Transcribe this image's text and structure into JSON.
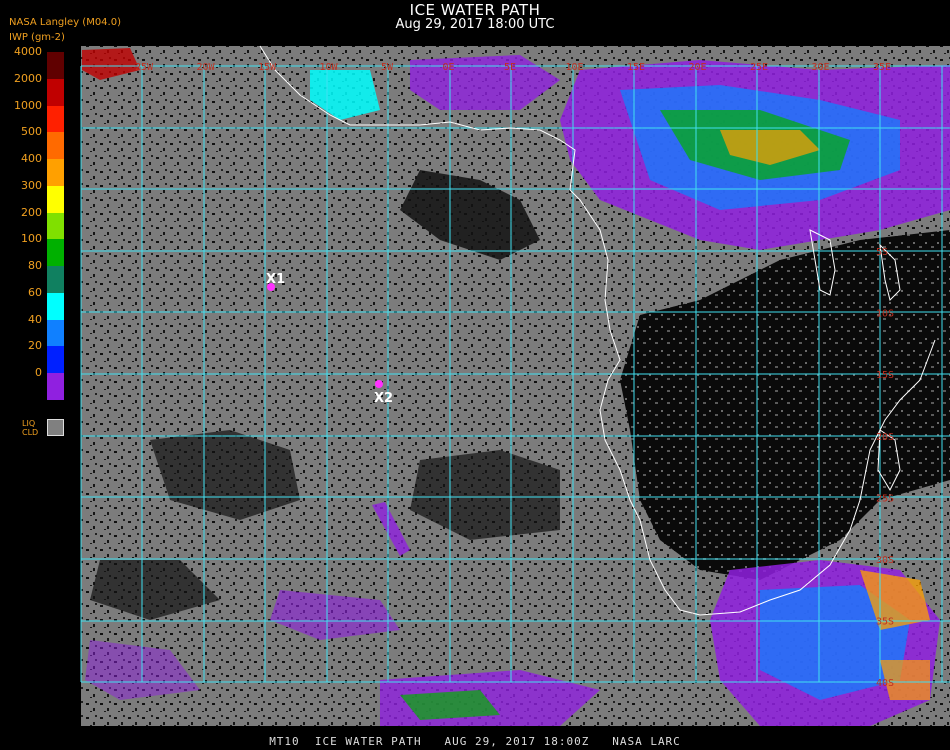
{
  "header": {
    "title": "ICE WATER PATH",
    "subtitle": "Aug 29, 2017 18:00 UTC",
    "organization": "NASA Langley (M04.0)",
    "unit_label": "IWP (gm-2)"
  },
  "legend": {
    "entries": [
      {
        "label": "4000",
        "color": "#600000"
      },
      {
        "label": "2000",
        "color": "#c00000"
      },
      {
        "label": "1000",
        "color": "#ff2000"
      },
      {
        "label": "500",
        "color": "#ff6a00"
      },
      {
        "label": "400",
        "color": "#ffa000"
      },
      {
        "label": "300",
        "color": "#ffff00"
      },
      {
        "label": "200",
        "color": "#80e000"
      },
      {
        "label": "100",
        "color": "#00b000"
      },
      {
        "label": "80",
        "color": "#108060"
      },
      {
        "label": "60",
        "color": "#00ffff"
      },
      {
        "label": "40",
        "color": "#1080ff"
      },
      {
        "label": "20",
        "color": "#0020ff"
      },
      {
        "label": "0",
        "color": "#9020e0"
      }
    ],
    "liquid_cloud_label_line1": "LIQ",
    "liquid_cloud_label_line2": "CLD",
    "liquid_cloud_color": "#808080"
  },
  "map": {
    "grid_color": "#40e0f0",
    "coast_color": "#ffffff",
    "longitude_labels": [
      "25W",
      "20W",
      "15W",
      "10W",
      "5W",
      "0E",
      "5E",
      "10E",
      "15E",
      "20E",
      "25E",
      "30E",
      "35E"
    ],
    "latitude_labels": [
      "5S",
      "10S",
      "15S",
      "20S",
      "25S",
      "30S",
      "35S",
      "40S"
    ],
    "markers": [
      {
        "label": "X1",
        "color": "#ff30ff"
      },
      {
        "label": "X2",
        "color": "#ff30ff"
      }
    ]
  },
  "footer": {
    "text": "MT10  ICE WATER PATH   AUG 29, 2017 18:00Z   NASA LARC"
  }
}
